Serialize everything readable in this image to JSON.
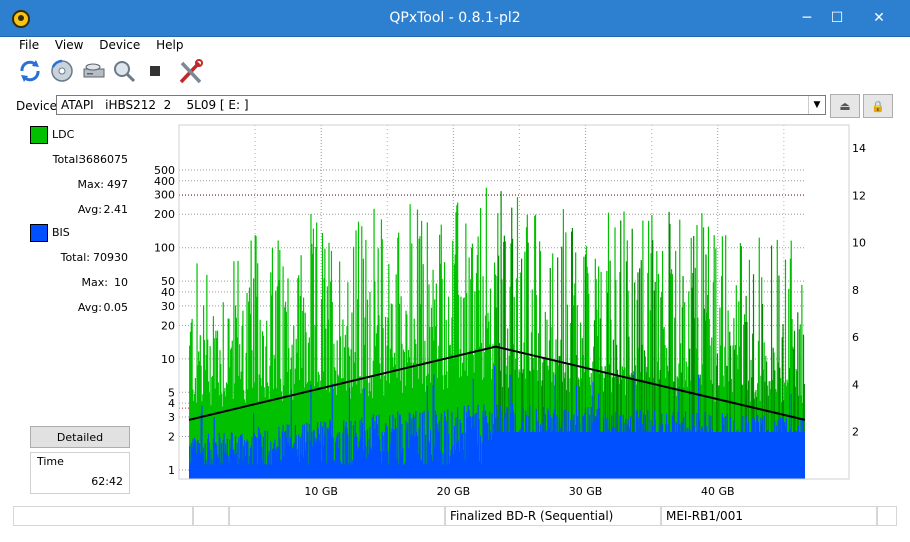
{
  "window": {
    "title": "QPxTool - 0.8.1-pl2",
    "minimize_glyph": "─",
    "maximize_glyph": "☐",
    "close_glyph": "✕"
  },
  "menu": [
    "File",
    "View",
    "Device",
    "Help"
  ],
  "toolbar": {
    "icons": [
      "refresh-icon",
      "disc-scan-icon",
      "device-info-icon",
      "media-test-icon",
      "stop-icon",
      "settings-tools-icon"
    ]
  },
  "device": {
    "label": "Device:",
    "value": "ATAPI   iHBS212  2    5L09 [ E: ]",
    "dropdown_glyph": "▼",
    "eject_glyph": "⏏",
    "lock_glyph": "🔒"
  },
  "ldc": {
    "name": "LDC",
    "color": "#00c000",
    "total_label": "Total:",
    "total": "3686075",
    "max_label": "Max:",
    "max": "497",
    "avg_label": "Avg:",
    "avg": "2.41"
  },
  "bis": {
    "name": "BIS",
    "color": "#0050ff",
    "total_label": "Total:",
    "total": "70930",
    "max_label": "Max:",
    "max": "10",
    "avg_label": "Avg:",
    "avg": "0.05"
  },
  "detailed_button": "Detailed",
  "time": {
    "label": "Time",
    "value": "62:42"
  },
  "chart_data": {
    "type": "bar",
    "x_unit": "GB",
    "xlim": [
      0,
      46.6
    ],
    "x_ticks": [
      10,
      20,
      30,
      40
    ],
    "x_tick_labels": [
      "10 GB",
      "20 GB",
      "30 GB",
      "40 GB"
    ],
    "y_left_scale": "log",
    "ylim_left": [
      1,
      500
    ],
    "y_left_ticks": [
      1,
      2,
      3,
      4,
      5,
      10,
      20,
      30,
      40,
      50,
      100,
      200,
      300,
      400,
      500
    ],
    "ylim_right": [
      0,
      14
    ],
    "y_right_ticks": [
      2,
      4,
      6,
      8,
      10,
      12,
      14
    ],
    "grid": true,
    "series": [
      {
        "name": "LDC",
        "color": "#00c000",
        "axis": "left",
        "typical_peak_start": 100,
        "typical_peak_middle": 400,
        "typical_peak_end": 150,
        "max": 497
      },
      {
        "name": "BIS",
        "color": "#0050ff",
        "axis": "left",
        "typical_level_start": 2,
        "typical_level_middle": 4,
        "typical_level_end": 3,
        "max": 10
      },
      {
        "name": "Speed",
        "color": "#000000",
        "axis": "right",
        "x": [
          0,
          23.2,
          46.6
        ],
        "values": [
          2.5,
          5.6,
          2.5
        ]
      }
    ]
  },
  "status": {
    "cells": [
      "",
      "",
      "",
      "Finalized BD-R (Sequential)",
      "MEI-RB1/001",
      ""
    ]
  }
}
